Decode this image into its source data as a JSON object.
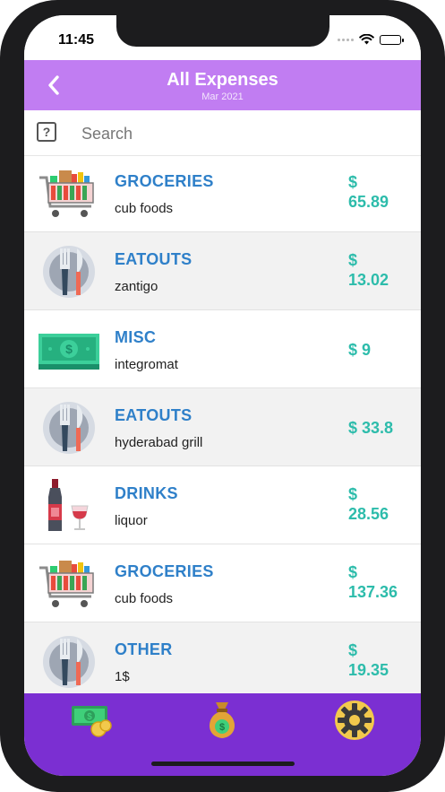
{
  "status_bar": {
    "time": "11:45"
  },
  "header": {
    "title": "All Expenses",
    "subtitle": "Mar 2021"
  },
  "search": {
    "placeholder": "Search",
    "icon": "help-icon"
  },
  "expenses": [
    {
      "category": "GROCERIES",
      "description": "cub foods",
      "amount_line1": "$",
      "amount_line2": "65.89",
      "icon": "shopping-cart-icon"
    },
    {
      "category": "EATOUTS",
      "description": "zantigo",
      "amount_line1": "$",
      "amount_line2": "13.02",
      "icon": "plate-cutlery-icon"
    },
    {
      "category": "MISC",
      "description": "integromat",
      "amount_line1": "$ 9",
      "amount_line2": "",
      "icon": "banknote-icon"
    },
    {
      "category": "EATOUTS",
      "description": "hyderabad grill",
      "amount_line1": "$ 33.8",
      "amount_line2": "",
      "icon": "plate-cutlery-icon"
    },
    {
      "category": "DRINKS",
      "description": "liquor",
      "amount_line1": "$",
      "amount_line2": "28.56",
      "icon": "wine-bottle-icon"
    },
    {
      "category": "GROCERIES",
      "description": "cub foods",
      "amount_line1": "$",
      "amount_line2": "137.36",
      "icon": "shopping-cart-icon"
    },
    {
      "category": "OTHER",
      "description": "1$",
      "amount_line1": "$",
      "amount_line2": "19.35",
      "icon": "plate-cutlery-icon"
    }
  ],
  "tabs": [
    {
      "icon": "money-coins-icon"
    },
    {
      "icon": "money-bag-icon"
    },
    {
      "icon": "settings-gear-icon"
    }
  ],
  "colors": {
    "header": "#c17df2",
    "tab_bar": "#7b2fd2",
    "category": "#2f80c9",
    "amount": "#2dbcab"
  }
}
